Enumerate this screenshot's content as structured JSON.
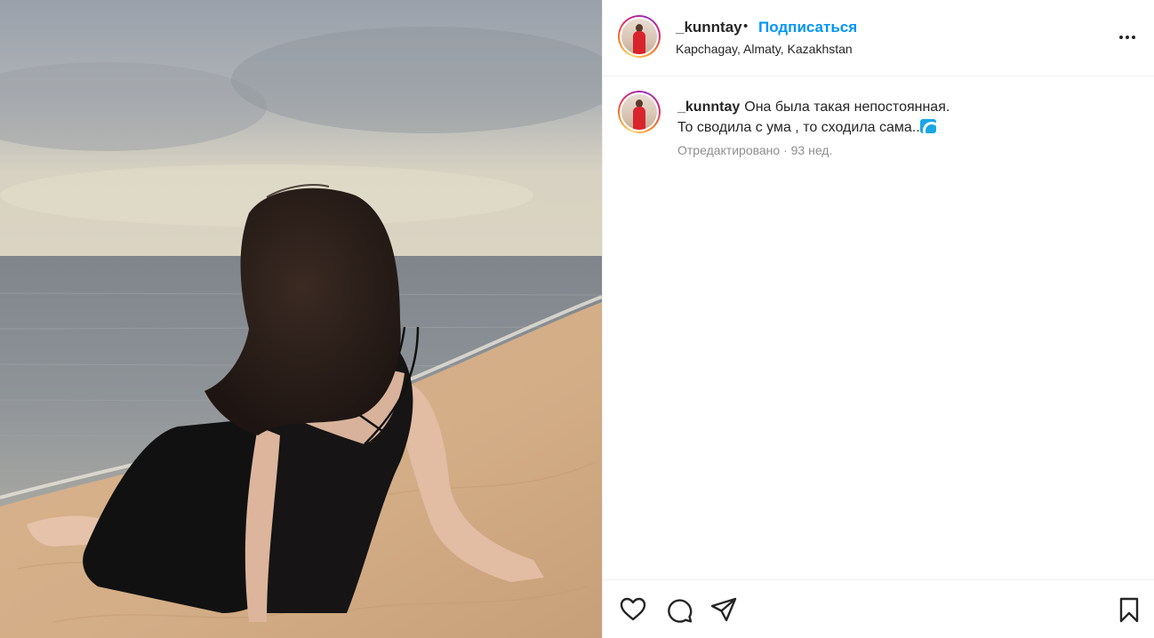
{
  "post": {
    "username": "_kunntay",
    "separator": "•",
    "follow_label": "Подписаться",
    "location": "Kapchagay, Almaty, Kazakhstan",
    "more_icon": "more-horizontal-icon"
  },
  "caption": {
    "username": "_kunntay",
    "line1": "Она была такая непостоянная.",
    "line2": "То сводила с ума , то сходила сама..",
    "emoji": "water-wave-icon",
    "meta": "Отредактировано · 93 нед."
  },
  "actions": {
    "like_icon": "heart-icon",
    "comment_icon": "comment-icon",
    "share_icon": "send-icon",
    "save_icon": "bookmark-icon"
  },
  "colors": {
    "accent": "#0095f6",
    "text": "#262626",
    "muted": "#8e8e8e",
    "border": "#efefef"
  }
}
